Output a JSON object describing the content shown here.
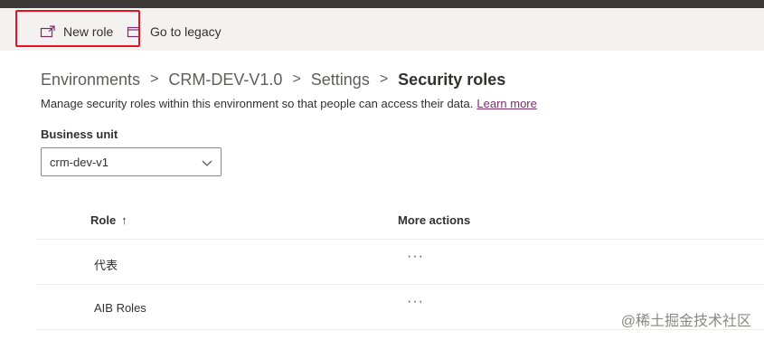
{
  "commandbar": {
    "new_role_label": "New role",
    "go_to_legacy_label": "Go to legacy"
  },
  "breadcrumb": {
    "items": [
      "Environments",
      "CRM-DEV-V1.0",
      "Settings"
    ],
    "separator": ">",
    "current": "Security roles"
  },
  "description": {
    "text": "Manage security roles within this environment so that people can access their data.",
    "link_label": "Learn more"
  },
  "business_unit": {
    "label": "Business unit",
    "selected_value": "crm-dev-v1"
  },
  "table": {
    "columns": {
      "role": "Role",
      "sort_indicator": "↑",
      "more_actions": "More actions"
    },
    "rows": [
      {
        "role": "代表",
        "more": "···"
      },
      {
        "role": "AIB Roles",
        "more": "···"
      }
    ]
  },
  "watermark": "@稀土掘金技术社区",
  "colors": {
    "accent": "#7a2d6b",
    "highlight_border": "#e81123",
    "commandbar_bg": "#f3f2f1",
    "topbar_bg": "#3b3a39"
  }
}
